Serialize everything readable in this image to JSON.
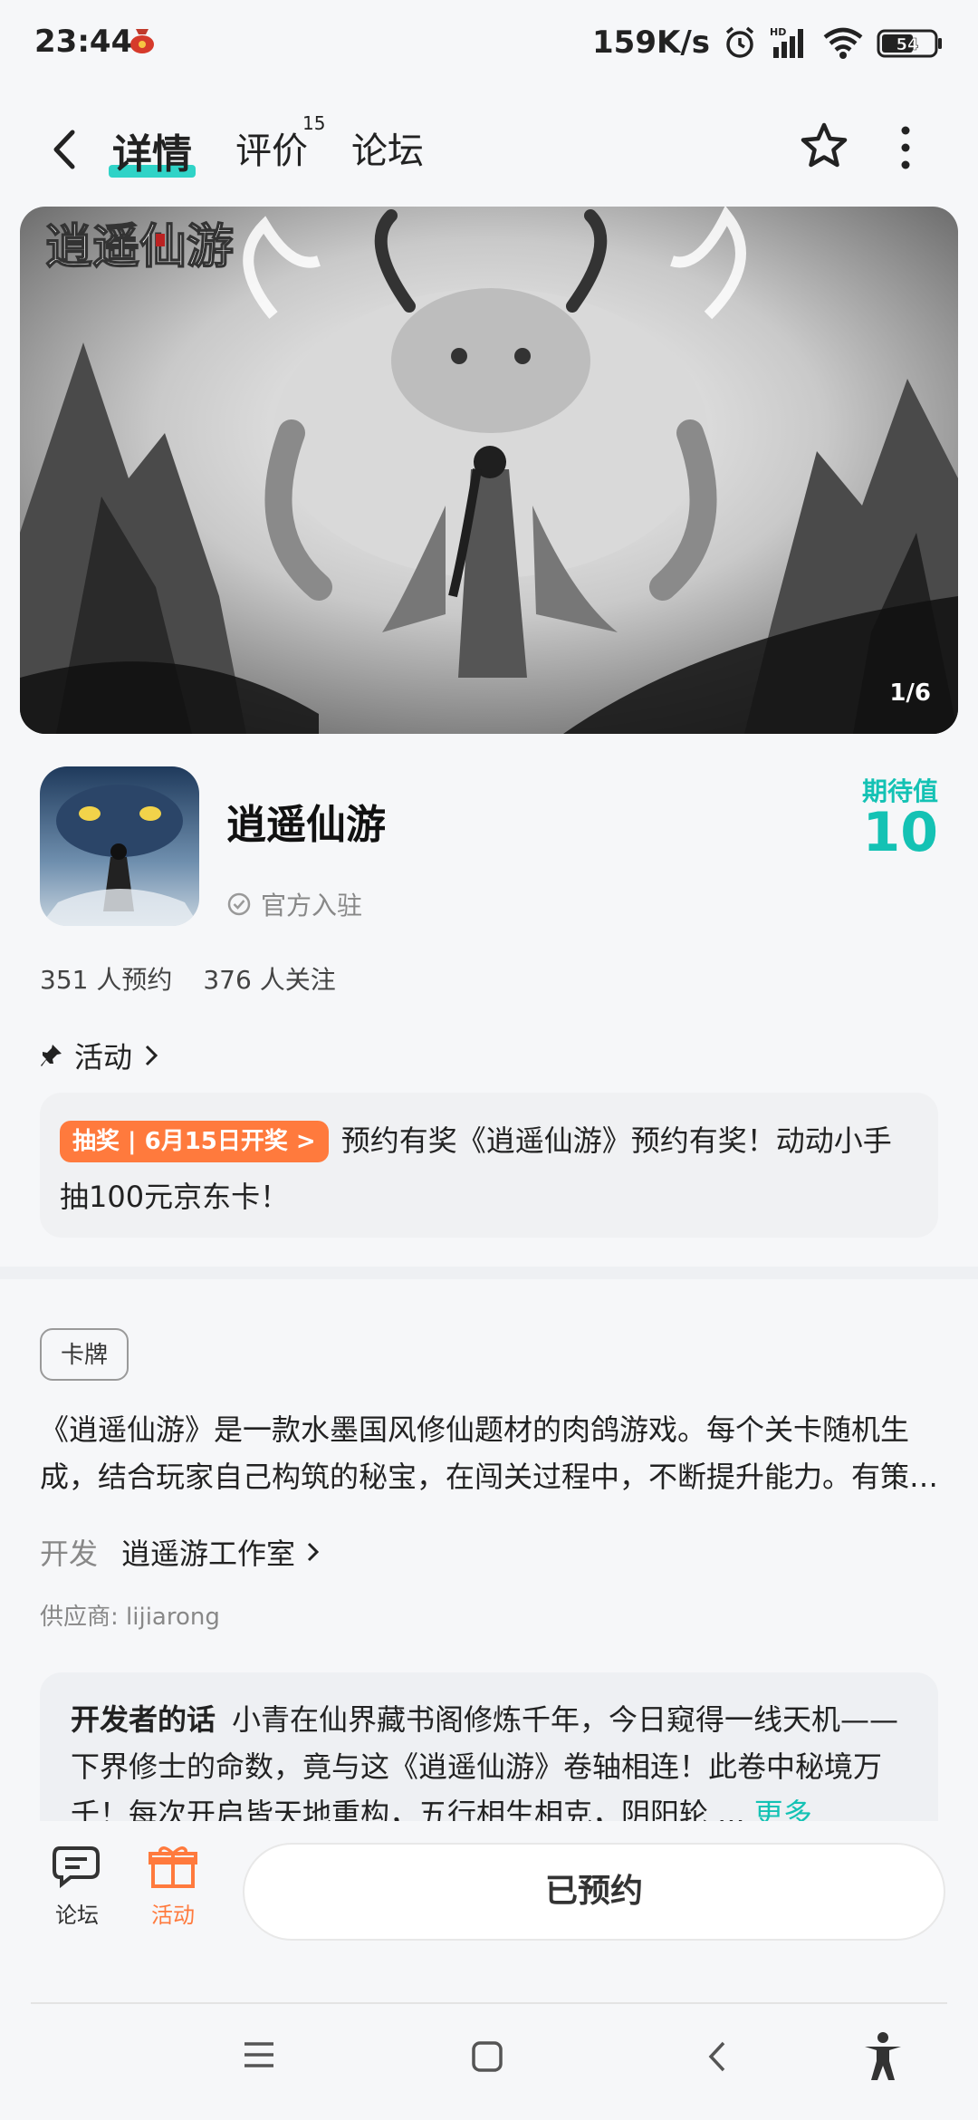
{
  "status_bar": {
    "time": "23:44",
    "speed": "159K/s",
    "battery": "54",
    "icons": [
      "red-bag-icon",
      "alarm-icon",
      "signal-hd-icon",
      "wifi-icon",
      "battery-icon"
    ]
  },
  "header": {
    "tabs": [
      {
        "label": "详情",
        "active": true
      },
      {
        "label": "评价",
        "badge": "15"
      },
      {
        "label": "论坛"
      }
    ]
  },
  "banner": {
    "counter": "1/6",
    "logo_text": "逍遥仙游"
  },
  "game": {
    "title": "逍遥仙游",
    "official_label": "官方入驻",
    "expect_label": "期待值",
    "expect_value": "10",
    "reservations": "351 人预约",
    "followers": "376 人关注"
  },
  "activity": {
    "heading": "活动",
    "pill": "抽奖 | 6月15日开奖 >",
    "text": "预约有奖《逍遥仙游》预约有奖！动动小手抽100元京东卡！"
  },
  "details": {
    "genre_tag": "卡牌",
    "description": "《逍遥仙游》是一款水墨国风修仙题材的肉鸽游戏。每个关卡随机生成，结合玩家自己构筑的秘宝，在闯关过程中，不断提升能力。有策…",
    "developer_label": "开发",
    "developer_name": "逍遥游工作室",
    "supplier": "供应商: lijiarong",
    "devnote_title": "开发者的话",
    "devnote_text": "小青在仙界藏书阁修炼千年，今日窥得一线天机——下界修士的命数，竟与这《逍遥仙游》卷轴相连！此卷中秘境万千！每次开启皆天地重构，五行相生相克，阴阳轮 ...",
    "devnote_more": "更多"
  },
  "bottom_bar": {
    "forum_label": "论坛",
    "activity_label": "活动",
    "reserved_label": "已预约"
  },
  "colors": {
    "accent_teal": "#14c2b4",
    "underline_teal": "#2fd3c7",
    "orange": "#ff7a3d"
  }
}
